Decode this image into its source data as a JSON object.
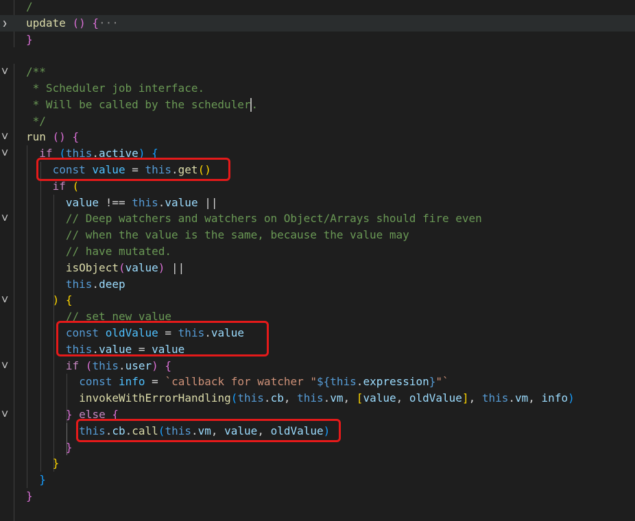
{
  "editor": {
    "colors": {
      "background": "#1e1e1e",
      "keyword": "#569cd6",
      "control": "#c586c0",
      "variable": "#9cdcfe",
      "function": "#dcdcaa",
      "string": "#ce9178",
      "comment": "#6a9955",
      "highlight_box": "#e51a1a"
    },
    "fold_icons": [
      "chevron-right-icon",
      "chevron-down-icon"
    ],
    "lines": [
      {
        "indent": 1,
        "fold": "",
        "tokens": [
          {
            "t": "/",
            "c": "cmt"
          }
        ]
      },
      {
        "indent": 1,
        "fold": "right",
        "highlight": true,
        "tokens": [
          {
            "t": "update",
            "c": "fn"
          },
          {
            "t": " ",
            "c": "pl"
          },
          {
            "t": "()",
            "c": "b2"
          },
          {
            "t": " ",
            "c": "pl"
          },
          {
            "t": "{",
            "c": "b2"
          },
          {
            "t": "···",
            "c": "ell"
          }
        ]
      },
      {
        "indent": 1,
        "fold": "",
        "tokens": [
          {
            "t": "}",
            "c": "b2"
          }
        ]
      },
      {
        "indent": 0,
        "fold": "",
        "tokens": []
      },
      {
        "indent": 1,
        "fold": "down",
        "tokens": [
          {
            "t": "/**",
            "c": "cmt"
          }
        ]
      },
      {
        "indent": 1,
        "fold": "",
        "tokens": [
          {
            "t": " * Scheduler job interface.",
            "c": "cmt"
          }
        ]
      },
      {
        "indent": 1,
        "fold": "",
        "cursor_after": true,
        "tokens": [
          {
            "t": " * Will be called by the scheduler",
            "c": "cmt"
          },
          {
            "t": ".",
            "c": "cmt"
          }
        ]
      },
      {
        "indent": 1,
        "fold": "",
        "tokens": [
          {
            "t": " */",
            "c": "cmt"
          }
        ]
      },
      {
        "indent": 1,
        "fold": "down",
        "tokens": [
          {
            "t": "run",
            "c": "fn"
          },
          {
            "t": " ",
            "c": "pl"
          },
          {
            "t": "()",
            "c": "b2"
          },
          {
            "t": " ",
            "c": "pl"
          },
          {
            "t": "{",
            "c": "b2"
          }
        ]
      },
      {
        "indent": 2,
        "fold": "down",
        "tokens": [
          {
            "t": "if",
            "c": "ctl"
          },
          {
            "t": " ",
            "c": "pl"
          },
          {
            "t": "(",
            "c": "b3"
          },
          {
            "t": "this",
            "c": "kw"
          },
          {
            "t": ".",
            "c": "pl"
          },
          {
            "t": "active",
            "c": "var"
          },
          {
            "t": ")",
            "c": "b3"
          },
          {
            "t": " ",
            "c": "pl"
          },
          {
            "t": "{",
            "c": "b3"
          }
        ]
      },
      {
        "indent": 3,
        "fold": "",
        "tokens": [
          {
            "t": "const",
            "c": "kw"
          },
          {
            "t": " ",
            "c": "pl"
          },
          {
            "t": "value",
            "c": "cst"
          },
          {
            "t": " = ",
            "c": "pl"
          },
          {
            "t": "this",
            "c": "kw"
          },
          {
            "t": ".",
            "c": "pl"
          },
          {
            "t": "get",
            "c": "fn"
          },
          {
            "t": "()",
            "c": "b1"
          }
        ]
      },
      {
        "indent": 3,
        "fold": "",
        "tokens": [
          {
            "t": "if",
            "c": "ctl"
          },
          {
            "t": " ",
            "c": "pl"
          },
          {
            "t": "(",
            "c": "b1"
          }
        ]
      },
      {
        "indent": 4,
        "fold": "",
        "tokens": [
          {
            "t": "value",
            "c": "var"
          },
          {
            "t": " !== ",
            "c": "pl"
          },
          {
            "t": "this",
            "c": "kw"
          },
          {
            "t": ".",
            "c": "pl"
          },
          {
            "t": "value",
            "c": "var"
          },
          {
            "t": " ||",
            "c": "pl"
          }
        ]
      },
      {
        "indent": 4,
        "fold": "down",
        "tokens": [
          {
            "t": "// Deep watchers and watchers on Object/Arrays should fire even",
            "c": "cmt"
          }
        ]
      },
      {
        "indent": 4,
        "fold": "",
        "tokens": [
          {
            "t": "// when the value is the same, because the value may",
            "c": "cmt"
          }
        ]
      },
      {
        "indent": 4,
        "fold": "",
        "tokens": [
          {
            "t": "// have mutated.",
            "c": "cmt"
          }
        ]
      },
      {
        "indent": 4,
        "fold": "",
        "tokens": [
          {
            "t": "isObject",
            "c": "fn"
          },
          {
            "t": "(",
            "c": "b2"
          },
          {
            "t": "value",
            "c": "var"
          },
          {
            "t": ")",
            "c": "b2"
          },
          {
            "t": " ||",
            "c": "pl"
          }
        ]
      },
      {
        "indent": 4,
        "fold": "",
        "tokens": [
          {
            "t": "this",
            "c": "kw"
          },
          {
            "t": ".",
            "c": "pl"
          },
          {
            "t": "deep",
            "c": "var"
          }
        ]
      },
      {
        "indent": 3,
        "fold": "down",
        "tokens": [
          {
            "t": ")",
            "c": "b1"
          },
          {
            "t": " ",
            "c": "pl"
          },
          {
            "t": "{",
            "c": "b1"
          }
        ]
      },
      {
        "indent": 4,
        "fold": "",
        "tokens": [
          {
            "t": "// set new value",
            "c": "cmt"
          }
        ]
      },
      {
        "indent": 4,
        "fold": "",
        "tokens": [
          {
            "t": "const",
            "c": "kw"
          },
          {
            "t": " ",
            "c": "pl"
          },
          {
            "t": "oldValue",
            "c": "cst"
          },
          {
            "t": " = ",
            "c": "pl"
          },
          {
            "t": "this",
            "c": "kw"
          },
          {
            "t": ".",
            "c": "pl"
          },
          {
            "t": "value",
            "c": "var"
          }
        ]
      },
      {
        "indent": 4,
        "fold": "",
        "tokens": [
          {
            "t": "this",
            "c": "kw"
          },
          {
            "t": ".",
            "c": "pl"
          },
          {
            "t": "value",
            "c": "var"
          },
          {
            "t": " = ",
            "c": "pl"
          },
          {
            "t": "value",
            "c": "var"
          }
        ]
      },
      {
        "indent": 4,
        "fold": "down",
        "tokens": [
          {
            "t": "if",
            "c": "ctl"
          },
          {
            "t": " ",
            "c": "pl"
          },
          {
            "t": "(",
            "c": "b2"
          },
          {
            "t": "this",
            "c": "kw"
          },
          {
            "t": ".",
            "c": "pl"
          },
          {
            "t": "user",
            "c": "var"
          },
          {
            "t": ")",
            "c": "b2"
          },
          {
            "t": " ",
            "c": "pl"
          },
          {
            "t": "{",
            "c": "b2"
          }
        ]
      },
      {
        "indent": 5,
        "fold": "",
        "tokens": [
          {
            "t": "const",
            "c": "kw"
          },
          {
            "t": " ",
            "c": "pl"
          },
          {
            "t": "info",
            "c": "cst"
          },
          {
            "t": " = ",
            "c": "pl"
          },
          {
            "t": "`callback for watcher \"",
            "c": "str"
          },
          {
            "t": "${",
            "c": "kw"
          },
          {
            "t": "this",
            "c": "kw"
          },
          {
            "t": ".",
            "c": "pl"
          },
          {
            "t": "expression",
            "c": "var"
          },
          {
            "t": "}",
            "c": "kw"
          },
          {
            "t": "\"`",
            "c": "str"
          }
        ]
      },
      {
        "indent": 5,
        "fold": "",
        "tokens": [
          {
            "t": "invokeWithErrorHandling",
            "c": "fn"
          },
          {
            "t": "(",
            "c": "b3"
          },
          {
            "t": "this",
            "c": "kw"
          },
          {
            "t": ".",
            "c": "pl"
          },
          {
            "t": "cb",
            "c": "var"
          },
          {
            "t": ", ",
            "c": "pl"
          },
          {
            "t": "this",
            "c": "kw"
          },
          {
            "t": ".",
            "c": "pl"
          },
          {
            "t": "vm",
            "c": "var"
          },
          {
            "t": ", ",
            "c": "pl"
          },
          {
            "t": "[",
            "c": "b1"
          },
          {
            "t": "value",
            "c": "var"
          },
          {
            "t": ", ",
            "c": "pl"
          },
          {
            "t": "oldValue",
            "c": "var"
          },
          {
            "t": "]",
            "c": "b1"
          },
          {
            "t": ", ",
            "c": "pl"
          },
          {
            "t": "this",
            "c": "kw"
          },
          {
            "t": ".",
            "c": "pl"
          },
          {
            "t": "vm",
            "c": "var"
          },
          {
            "t": ", ",
            "c": "pl"
          },
          {
            "t": "info",
            "c": "var"
          },
          {
            "t": ")",
            "c": "b3"
          }
        ]
      },
      {
        "indent": 4,
        "fold": "down",
        "tokens": [
          {
            "t": "}",
            "c": "b2"
          },
          {
            "t": " ",
            "c": "pl"
          },
          {
            "t": "else",
            "c": "ctl"
          },
          {
            "t": " ",
            "c": "pl"
          },
          {
            "t": "{",
            "c": "b2"
          }
        ]
      },
      {
        "indent": 5,
        "fold": "",
        "tokens": [
          {
            "t": "this",
            "c": "kw"
          },
          {
            "t": ".",
            "c": "pl"
          },
          {
            "t": "cb",
            "c": "var"
          },
          {
            "t": ".",
            "c": "pl"
          },
          {
            "t": "call",
            "c": "fn"
          },
          {
            "t": "(",
            "c": "b3"
          },
          {
            "t": "this",
            "c": "kw"
          },
          {
            "t": ".",
            "c": "pl"
          },
          {
            "t": "vm",
            "c": "var"
          },
          {
            "t": ", ",
            "c": "pl"
          },
          {
            "t": "value",
            "c": "var"
          },
          {
            "t": ", ",
            "c": "pl"
          },
          {
            "t": "oldValue",
            "c": "var"
          },
          {
            "t": ")",
            "c": "b3"
          }
        ]
      },
      {
        "indent": 4,
        "fold": "",
        "tokens": [
          {
            "t": "}",
            "c": "b2"
          }
        ]
      },
      {
        "indent": 3,
        "fold": "",
        "tokens": [
          {
            "t": "}",
            "c": "b1"
          }
        ]
      },
      {
        "indent": 2,
        "fold": "",
        "tokens": [
          {
            "t": "}",
            "c": "b3"
          }
        ]
      },
      {
        "indent": 1,
        "fold": "",
        "tokens": [
          {
            "t": "}",
            "c": "b2"
          }
        ]
      }
    ],
    "highlight_boxes": [
      {
        "name": "highlight-const-value"
      },
      {
        "name": "highlight-old-value"
      },
      {
        "name": "highlight-cb-call"
      }
    ]
  }
}
